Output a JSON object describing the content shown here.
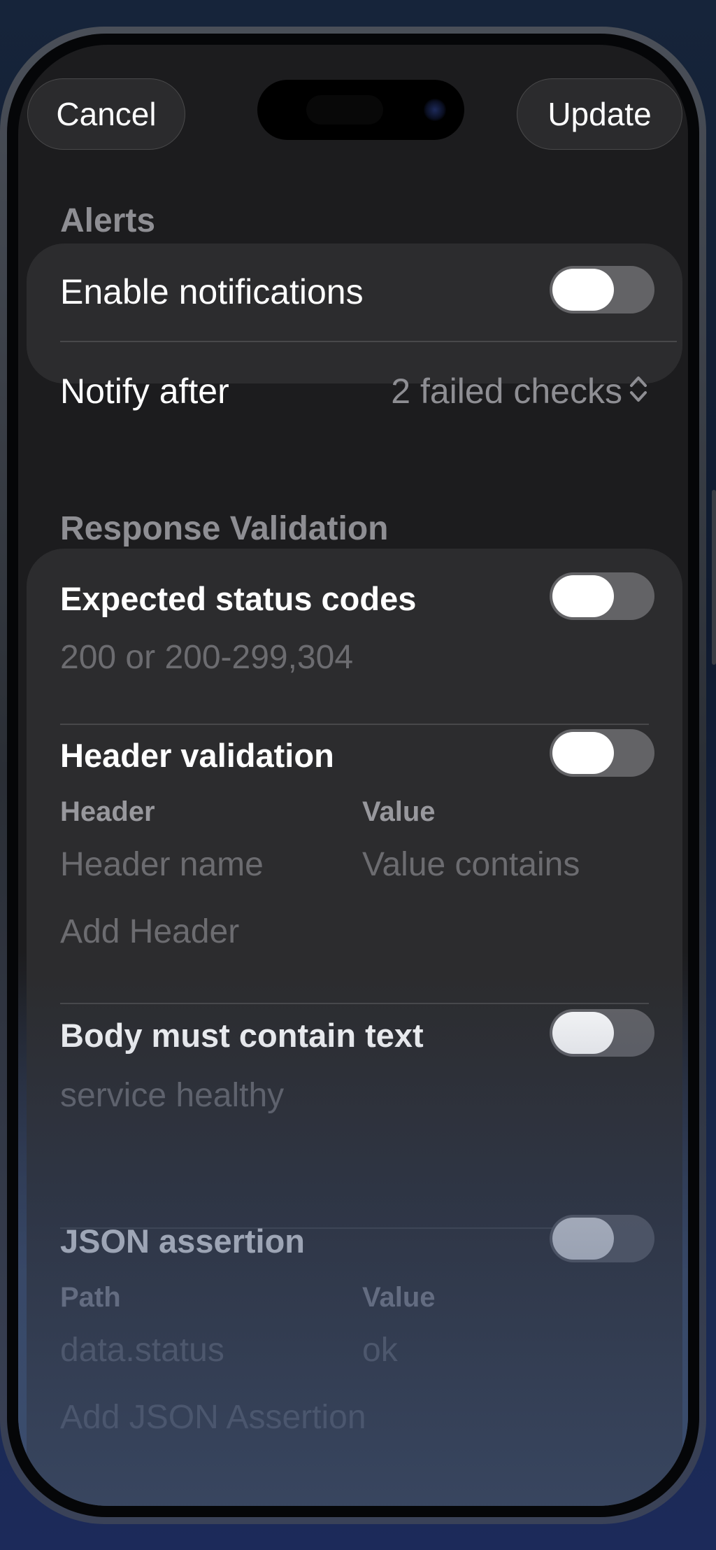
{
  "toolbar": {
    "cancel_label": "Cancel",
    "update_label": "Update"
  },
  "alerts": {
    "title": "Alerts",
    "enable_notifications": {
      "label": "Enable notifications",
      "on": false
    },
    "notify_after": {
      "label": "Notify after",
      "value": "2 failed checks"
    }
  },
  "response_validation": {
    "title": "Response Validation",
    "expected_status_codes": {
      "label": "Expected status codes",
      "on": false,
      "placeholder": "200 or 200-299,304"
    },
    "header_validation": {
      "label": "Header validation",
      "on": false,
      "col_header": "Header",
      "col_value": "Value",
      "header_placeholder": "Header name",
      "value_placeholder": "Value contains",
      "add_label": "Add Header"
    },
    "body_contains": {
      "label": "Body must contain text",
      "on": false,
      "placeholder": "service healthy"
    },
    "json_assertion": {
      "label": "JSON assertion",
      "on": false,
      "col_path": "Path",
      "col_value": "Value",
      "path_placeholder": "data.status",
      "value_placeholder": "ok",
      "add_label": "Add JSON Assertion"
    }
  },
  "colors": {
    "accent_text": "#ffffff",
    "secondary_text": "#8e8e93",
    "card_background": "#2c2c2e",
    "toggle_off": "#636366"
  }
}
